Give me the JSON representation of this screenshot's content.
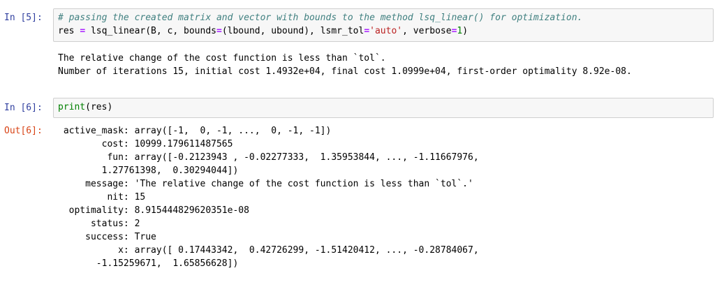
{
  "cells": {
    "cell5": {
      "prompt": "In [5]:",
      "comment_line": "# passing the created matrix and vector with bounds to the method lsq_linear() for optimization.",
      "code_line_2": {
        "lhs": "res ",
        "eq": "=",
        "call_start": " lsq_linear(B, c, bounds",
        "eq2": "=",
        "call_mid": "(lbound, ubound), lsmr_tol",
        "eq3": "=",
        "str_val": "'auto'",
        "call_mid2": ", verbose",
        "eq4": "=",
        "num_val": "1",
        "call_end": ")"
      },
      "output_lines": [
        "The relative change of the cost function is less than `tol`.",
        "Number of iterations 15, initial cost 1.4932e+04, final cost 1.0999e+04, first-order optimality 8.92e-08."
      ]
    },
    "cell6": {
      "prompt": "In [6]:",
      "code": {
        "func": "print",
        "args": "(res)"
      },
      "out_prompt": "Out[6]:",
      "output_lines": [
        " active_mask: array([-1,  0, -1, ...,  0, -1, -1])",
        "        cost: 10999.179611487565",
        "         fun: array([-0.2123943 , -0.02277333,  1.35953844, ..., -1.11667976,",
        "        1.27761398,  0.30294044])",
        "     message: 'The relative change of the cost function is less than `tol`.'",
        "         nit: 15",
        "  optimality: 8.915444829620351e-08",
        "      status: 2",
        "     success: True",
        "           x: array([ 0.17443342,  0.42726299, -1.51420412, ..., -0.28784067,",
        "       -1.15259671,  1.65856628])"
      ]
    }
  }
}
